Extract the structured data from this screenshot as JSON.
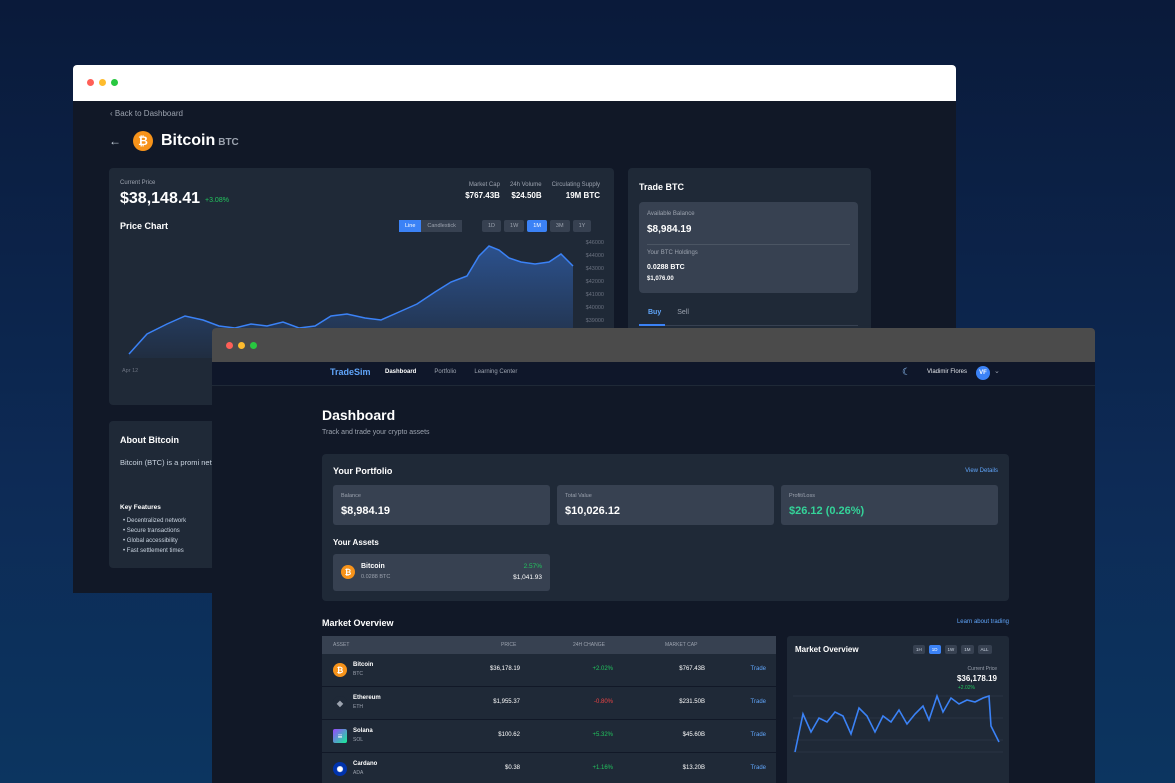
{
  "back_window": {
    "back_link": "Back to Dashboard",
    "coin": {
      "name": "Bitcoin",
      "symbol": "BTC"
    },
    "price_panel": {
      "current_price_label": "Current Price",
      "current_price": "$38,148.41",
      "change": "+3.08%",
      "stats": [
        {
          "label": "Market Cap",
          "value": "$767.43B"
        },
        {
          "label": "24h Volume",
          "value": "$24.50B"
        },
        {
          "label": "Circulating Supply",
          "value": "19M BTC"
        }
      ],
      "chart_title": "Price Chart",
      "chart_types": [
        "Line",
        "Candlestick"
      ],
      "ranges": [
        "1D",
        "1W",
        "1M",
        "3M",
        "1Y"
      ],
      "y_ticks": [
        "$46000",
        "$44000",
        "$43000",
        "$42000",
        "$41000",
        "$40000",
        "$39000"
      ],
      "first_date": "Apr 12"
    },
    "trade_panel": {
      "title": "Trade BTC",
      "available_balance_label": "Available Balance",
      "available_balance": "$8,984.19",
      "holdings_label": "Your BTC Holdings",
      "holdings_btc": "0.0288 BTC",
      "holdings_usd": "$1,076.00",
      "tabs": [
        "Buy",
        "Sell"
      ]
    },
    "about": {
      "title": "About Bitcoin",
      "text": "Bitcoin (BTC) is a promi network. It offers users investors and those look",
      "key_features_title": "Key Features",
      "features": [
        "Decentralized network",
        "Secure transactions",
        "Global accessibility",
        "Fast settlement times"
      ]
    }
  },
  "front_window": {
    "nav": {
      "brand": "TradeSim",
      "links": [
        "Dashboard",
        "Portfolio",
        "Learning Center"
      ],
      "user_name": "Vladimir Flores",
      "user_initials": "VF"
    },
    "title": "Dashboard",
    "subtitle": "Track and trade your crypto assets",
    "portfolio": {
      "title": "Your Portfolio",
      "view_details": "View Details",
      "cards": [
        {
          "label": "Balance",
          "value": "$8,984.19"
        },
        {
          "label": "Total Value",
          "value": "$10,026.12"
        },
        {
          "label": "Profit/Loss",
          "value": "$26.12 (0.26%)"
        }
      ],
      "assets_title": "Your Assets",
      "asset": {
        "name": "Bitcoin",
        "amount": "0.0288 BTC",
        "change": "2.57%",
        "value": "$1,041.93"
      }
    },
    "market": {
      "title": "Market Overview",
      "learn_link": "Learn about trading",
      "columns": [
        "ASSET",
        "PRICE",
        "24H CHANGE",
        "MARKET CAP"
      ],
      "rows": [
        {
          "name": "Bitcoin",
          "symbol": "BTC",
          "price": "$36,178.19",
          "change": "+2.02%",
          "market_cap": "$767.43B",
          "action": "Trade"
        },
        {
          "name": "Ethereum",
          "symbol": "ETH",
          "price": "$1,955.37",
          "change": "-0.80%",
          "market_cap": "$231.50B",
          "action": "Trade"
        },
        {
          "name": "Solana",
          "symbol": "SOL",
          "price": "$100.62",
          "change": "+5.32%",
          "market_cap": "$45.60B",
          "action": "Trade"
        },
        {
          "name": "Cardano",
          "symbol": "ADA",
          "price": "$0.38",
          "change": "+1.16%",
          "market_cap": "$13.20B",
          "action": "Trade"
        }
      ]
    },
    "mini_chart": {
      "title": "Market Overview",
      "ranges": [
        "1H",
        "1D",
        "1W",
        "1M",
        "ALL"
      ],
      "current_price_label": "Current Price",
      "current_price": "$36,178.19",
      "change": "+2.02%"
    }
  },
  "colors": {
    "accent": "#3b82f6",
    "positive": "#22c55e",
    "negative": "#ef4444",
    "bitcoin": "#f7931a"
  }
}
